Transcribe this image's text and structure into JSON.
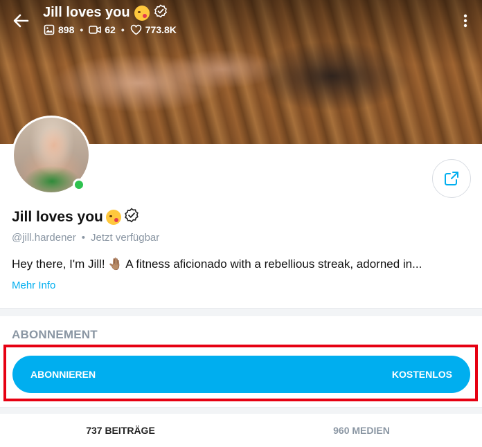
{
  "header": {
    "title": "Jill loves you",
    "stats": {
      "photos": "898",
      "videos": "62",
      "likes": "773.8K"
    }
  },
  "profile": {
    "name": "Jill loves you",
    "handle": "@jill.hardener",
    "status": "Jetzt verfügbar",
    "bio": "Hey there, I'm Jill! 🤚🏽 A fitness aficionado with a rebellious streak, adorned in...",
    "more_label": "Mehr Info"
  },
  "subscription": {
    "heading": "ABONNEMENT",
    "button_label": "ABONNIEREN",
    "price_label": "KOSTENLOS"
  },
  "tabs": [
    {
      "label": "737 BEITRÄGE"
    },
    {
      "label": "960 MEDIEN"
    }
  ],
  "colors": {
    "accent": "#00aeef",
    "online": "#2ec24f",
    "highlight_border": "#e60012",
    "muted": "#8a96a3"
  },
  "icons": {
    "back": "arrow-left-icon",
    "photos": "image-icon",
    "videos": "video-icon",
    "likes": "heart-icon",
    "more": "kebab-menu-icon",
    "verified": "verified-badge-icon",
    "share": "share-icon",
    "emoji": "kissing-face-emoji"
  }
}
